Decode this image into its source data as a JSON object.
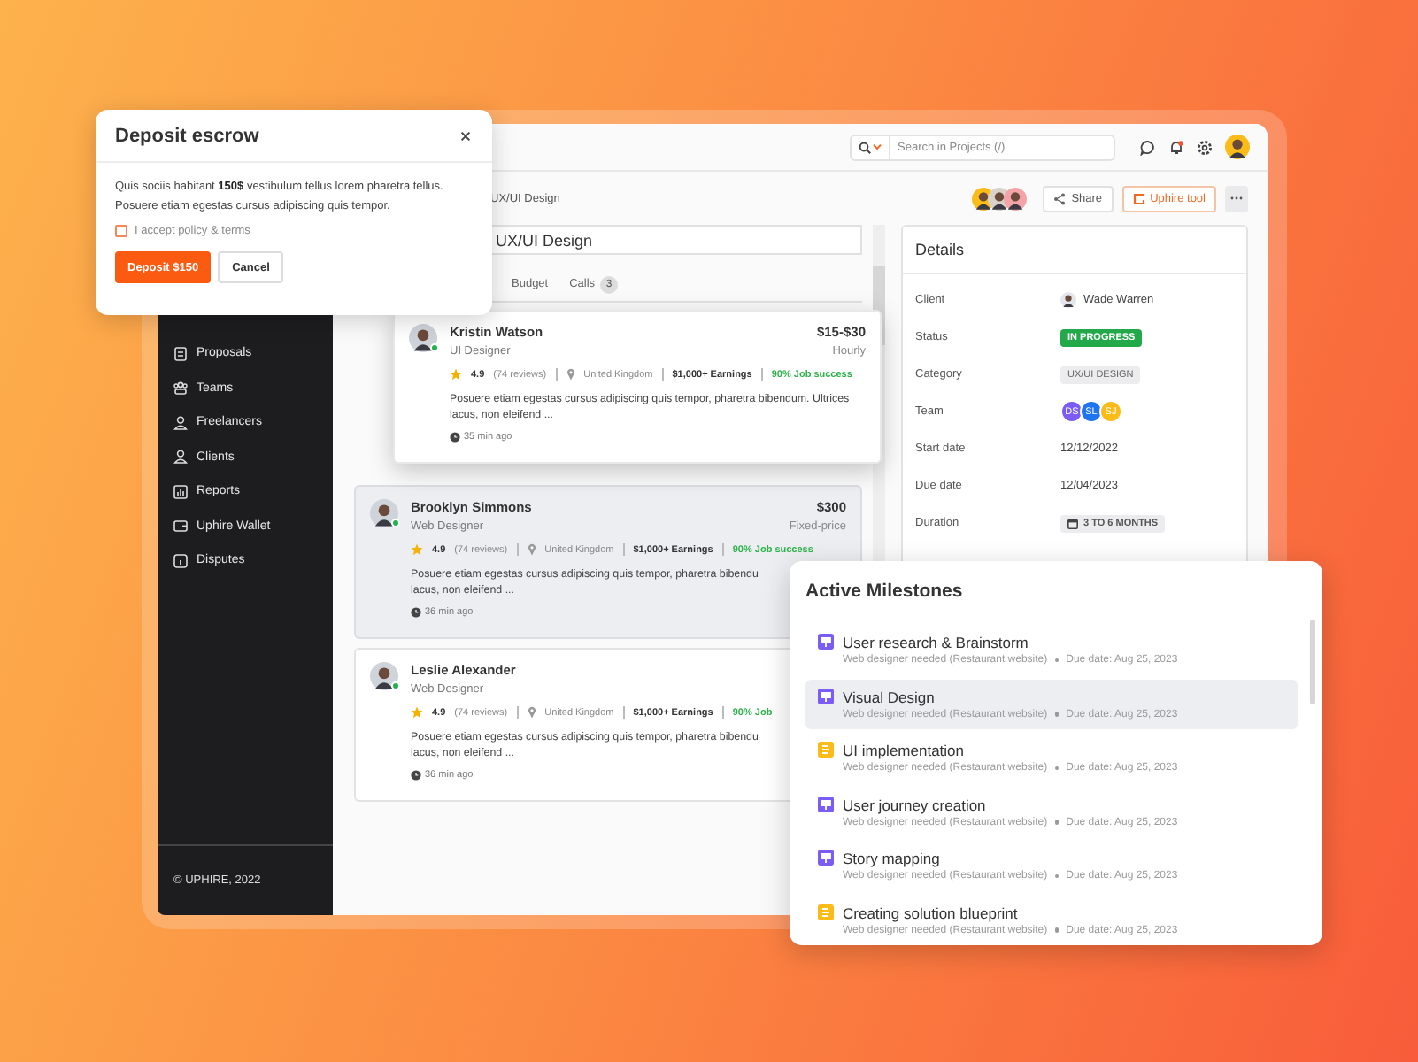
{
  "topbar": {
    "search_placeholder": "Search in Projects (/)"
  },
  "sidebar": {
    "items": [
      {
        "kind": "proposals",
        "label": "Proposals"
      },
      {
        "kind": "teams",
        "label": "Teams"
      },
      {
        "kind": "person",
        "label": "Freelancers"
      },
      {
        "kind": "person",
        "label": "Clients"
      },
      {
        "kind": "reports",
        "label": "Reports"
      },
      {
        "kind": "wallet",
        "label": "Uphire Wallet"
      },
      {
        "kind": "disputes",
        "label": "Disputes"
      }
    ],
    "footer": "© UPHIRE, 2022"
  },
  "breadcrumb": "UX/UI Design",
  "header_actions": {
    "share": "Share",
    "tool": "Uphire tool"
  },
  "title_field": {
    "value": "UX/UI Design"
  },
  "tabs": [
    {
      "label": "Budget",
      "selected": false
    },
    {
      "label": "Calls",
      "count": "3",
      "selected": false
    }
  ],
  "freelancers": [
    {
      "name": "Kristin Watson",
      "role": "UI Designer",
      "price": "$15-$30",
      "rate_type": "Hourly",
      "rating": "4.9",
      "reviews": "(74 reviews)",
      "location": "United Kingdom",
      "earnings": "$1,000+ Earnings",
      "success": "90% Job success",
      "description": [
        "Posuere etiam egestas cursus adipiscing quis tempor, pharetra bibendum. Ultrices",
        "lacus, non eleifend ..."
      ],
      "time": "35 min ago",
      "online": true,
      "selected": false,
      "floating": true
    },
    {
      "name": "Brooklyn Simmons",
      "role": "Web Designer",
      "price": "$300",
      "rate_type": "Fixed-price",
      "rating": "4.9",
      "reviews": "(74 reviews)",
      "location": "United Kingdom",
      "earnings": "$1,000+ Earnings",
      "success": "90% Job success",
      "description": [
        "Posuere etiam egestas cursus adipiscing quis tempor, pharetra bibendu",
        "lacus, non eleifend ..."
      ],
      "time": "36 min ago",
      "online": true,
      "selected": true,
      "floating": false
    },
    {
      "name": "Leslie Alexander",
      "role": "Web Designer",
      "rating": "4.9",
      "reviews": "(74 reviews)",
      "location": "United Kingdom",
      "earnings": "$1,000+ Earnings",
      "success": "90% Job",
      "description": [
        "Posuere etiam egestas cursus adipiscing quis tempor, pharetra bibendu",
        "lacus, non eleifend ..."
      ],
      "time": "36 min ago",
      "online": true,
      "selected": false,
      "floating": false
    }
  ],
  "details": {
    "title": "Details",
    "rows": [
      {
        "kind": "client",
        "label": "Client",
        "value": "Wade Warren"
      },
      {
        "kind": "status",
        "label": "Status",
        "value": "IN PROGRESS"
      },
      {
        "kind": "tag",
        "label": "Category",
        "value": "UX/UI DESIGN"
      },
      {
        "kind": "team",
        "label": "Team",
        "members": [
          {
            "initials": "DS",
            "color": "#7b5cf5"
          },
          {
            "initials": "SL",
            "color": "#1f74f0"
          },
          {
            "initials": "SJ",
            "color": "#fbbc1a"
          }
        ]
      },
      {
        "kind": "text",
        "label": "Start date",
        "value": "12/12/2022"
      },
      {
        "kind": "text",
        "label": "Due date",
        "value": "12/04/2023"
      },
      {
        "kind": "duration",
        "label": "Duration",
        "value": "3 TO 6 MONTHS"
      }
    ]
  },
  "modal": {
    "title": "Deposit escrow",
    "text": "Quis sociis habitant **150$** vestibulum tellus lorem pharetra tellus. Posuere etiam egestas cursus adipiscing quis tempor.",
    "checkbox": {
      "label": "I accept policy & terms",
      "checked": false
    },
    "primary": "Deposit $150",
    "secondary": "Cancel"
  },
  "milestones": {
    "title": "Active Milestones",
    "items": [
      {
        "kind": "signpost",
        "color": "#7b5cf5",
        "name": "User research & Brainstorm",
        "project": "Web designer needed (Restaurant website)",
        "due": "Due date: Aug 25, 2023",
        "selected": false
      },
      {
        "kind": "signpost",
        "color": "#7b5cf5",
        "name": "Visual Design",
        "project": "Web designer needed (Restaurant website)",
        "due": "Due date: Aug 25, 2023",
        "selected": true
      },
      {
        "kind": "layers",
        "color": "#fbbc1a",
        "name": "UI implementation",
        "project": "Web designer needed (Restaurant website)",
        "due": "Due date: Aug 25, 2023",
        "selected": false
      },
      {
        "kind": "signpost",
        "color": "#7b5cf5",
        "name": "User journey creation",
        "project": "Web designer needed (Restaurant website)",
        "due": "Due date: Aug 25, 2023",
        "selected": false
      },
      {
        "kind": "signpost",
        "color": "#7b5cf5",
        "name": "Story mapping",
        "project": "Web designer needed (Restaurant website)",
        "due": "Due date: Aug 25, 2023",
        "selected": false
      },
      {
        "kind": "layers",
        "color": "#fbbc1a",
        "name": "Creating solution blueprint",
        "project": "Web designer needed (Restaurant website)",
        "due": "Due date: Aug 25, 2023",
        "selected": false
      }
    ]
  }
}
